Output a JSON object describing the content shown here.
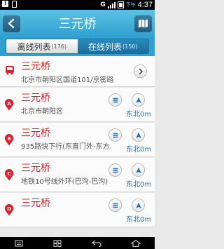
{
  "statusbar": {
    "network": "G",
    "ampm": "下午",
    "time": "4:37"
  },
  "header": {
    "title": "三元桥"
  },
  "tabs": [
    {
      "label": "离线列表",
      "count": "(176)",
      "active": false
    },
    {
      "label": "在线列表",
      "count": "(150)",
      "active": true
    }
  ],
  "items": [
    {
      "icon": "bus-icon",
      "title": "三元桥",
      "subtitle": "北京市朝阳区国道101/京密路",
      "distance": ""
    },
    {
      "marker": "A",
      "title": "三元桥",
      "subtitle": "北京市朝阳区",
      "distance": "东北0m"
    },
    {
      "marker": "B",
      "title": "三元桥",
      "subtitle": "935路快下行(东直门外-东方...",
      "distance": "东北0m"
    },
    {
      "marker": "C",
      "title": "三元桥",
      "subtitle": "地铁10号线外环(巴沟-巴沟)",
      "distance": "东北0m"
    },
    {
      "marker": "D",
      "title": "三元桥",
      "subtitle": "",
      "distance": "东北0m"
    }
  ],
  "colors": {
    "accent": "#2fa0d0",
    "poi_title": "#d8232a",
    "distance": "#1f6fb5"
  }
}
